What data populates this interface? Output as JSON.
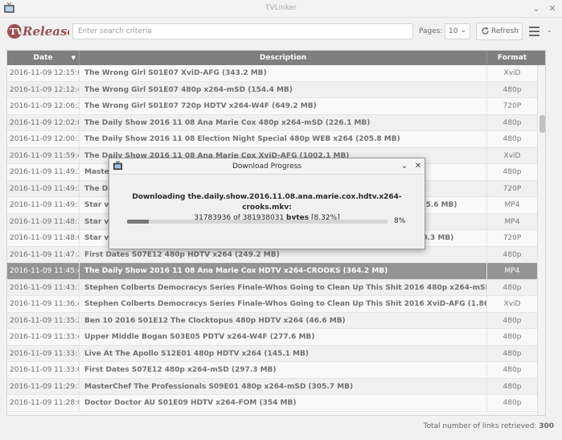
{
  "window": {
    "title": "TVLinker",
    "icon": "tv-icon"
  },
  "toolbar": {
    "logo_text": "TV Release",
    "search_placeholder": "Enter search criteria",
    "pages_label": "Pages:",
    "pages_value": "10",
    "refresh_label": "Refresh",
    "menu_icon": "hamburger-icon"
  },
  "table": {
    "headers": {
      "date": "Date",
      "description": "Description",
      "format": "Format"
    },
    "rows": [
      {
        "date": "2016-11-09 12:15:06",
        "desc": "The Wrong Girl S01E07 XviD-AFG  (343.2 MB)",
        "fmt": "XviD"
      },
      {
        "date": "2016-11-09 12:12:41",
        "desc": "The Wrong Girl S01E07 480p x264-mSD  (154.4 MB)",
        "fmt": "480p"
      },
      {
        "date": "2016-11-09 12:06:34",
        "desc": "The Wrong Girl S01E07 720p HDTV x264-W4F  (649.2 MB)",
        "fmt": "720P"
      },
      {
        "date": "2016-11-09 12:02:06",
        "desc": "The Daily Show 2016 11 08 Ana Marie Cox 480p x264-mSD  (226.1 MB)",
        "fmt": "480p"
      },
      {
        "date": "2016-11-09 12:00:12",
        "desc": "The Daily Show 2016 11 08 Election Night Special 480p WEB x264  (205.8 MB)",
        "fmt": "480p"
      },
      {
        "date": "2016-11-09 11:59:40",
        "desc": "The Daily Show 2016 11 08 Ana Marie Cox XviD-AFG  (1002.1 MB)",
        "fmt": "XviD"
      },
      {
        "date": "2016-11-09 11:49:37",
        "desc": "Master",
        "fmt": "480p"
      },
      {
        "date": "2016-11-09 11:49:33",
        "desc": "The Da",
        "fmt": "720P"
      },
      {
        "date": "2016-11-09 11:49:13",
        "desc": "Star vs",
        "fmt": "MP4",
        "tail": "835.6 MB)"
      },
      {
        "date": "2016-11-09 11:48:19",
        "desc": "Star vs",
        "fmt": "MP4"
      },
      {
        "date": "2016-11-09 11:48:03",
        "desc": "Star vs",
        "fmt": "720P",
        "tail": "60.3 MB)"
      },
      {
        "date": "2016-11-09 11:47:20",
        "desc": "First Dates S07E12 480p HDTV x264  (249.2 MB)",
        "fmt": "480p"
      },
      {
        "date": "2016-11-09 11:45:43",
        "desc": "The Daily Show 2016 11 08 Ana Marie Cox HDTV x264-CROOKS  (364.2 MB)",
        "fmt": "MP4",
        "selected": true
      },
      {
        "date": "2016-11-09 11:43:10",
        "desc": "Stephen Colberts Democracys Series Finale-Whos Going to Clean Up This Shit 2016 480p x264-mSD  (389.1 MB)",
        "fmt": "480p"
      },
      {
        "date": "2016-11-09 11:36:45",
        "desc": "Stephen Colberts Democracys Series Finale-Whos Going to Clean Up This Shit 2016 XviD-AFG  (1.86 GB)",
        "fmt": "XviD"
      },
      {
        "date": "2016-11-09 11:35:27",
        "desc": "Ben 10 2016 S01E12 The Clocktopus 480p HDTV x264  (46.6 MB)",
        "fmt": "480p"
      },
      {
        "date": "2016-11-09 11:33:45",
        "desc": "Upper Middle Bogan S03E05 PDTV x264-W4F  (277.6 MB)",
        "fmt": "480p"
      },
      {
        "date": "2016-11-09 11:33:31",
        "desc": "Live At The Apollo S12E01 480p HDTV x264  (145.1 MB)",
        "fmt": "480p"
      },
      {
        "date": "2016-11-09 11:33:06",
        "desc": "First Dates S07E12 480p x264-mSD  (297.3 MB)",
        "fmt": "480p"
      },
      {
        "date": "2016-11-09 11:29:12",
        "desc": "MasterChef The Professionals S09E01 480p x264-mSD  (305.7 MB)",
        "fmt": "480p"
      },
      {
        "date": "2016-11-09 11:28:02",
        "desc": "Doctor Doctor AU S01E09 HDTV x264-FOM  (354 MB)",
        "fmt": "480p"
      }
    ]
  },
  "footer": {
    "label": "Total number of links retrieved:",
    "count": "300"
  },
  "dialog": {
    "title": "Download Progress",
    "line1": "Downloading the.daily.show.2016.11.08.ana.marie.cox.hdtv.x264-crooks.mkv:",
    "line2_done": "31783936",
    "line2_of": "of",
    "line2_total": "381938031",
    "line2_unit": "bytes",
    "line2_pct": "[8.32%]",
    "percent_label": "8%",
    "progress_fraction": 0.0832
  }
}
